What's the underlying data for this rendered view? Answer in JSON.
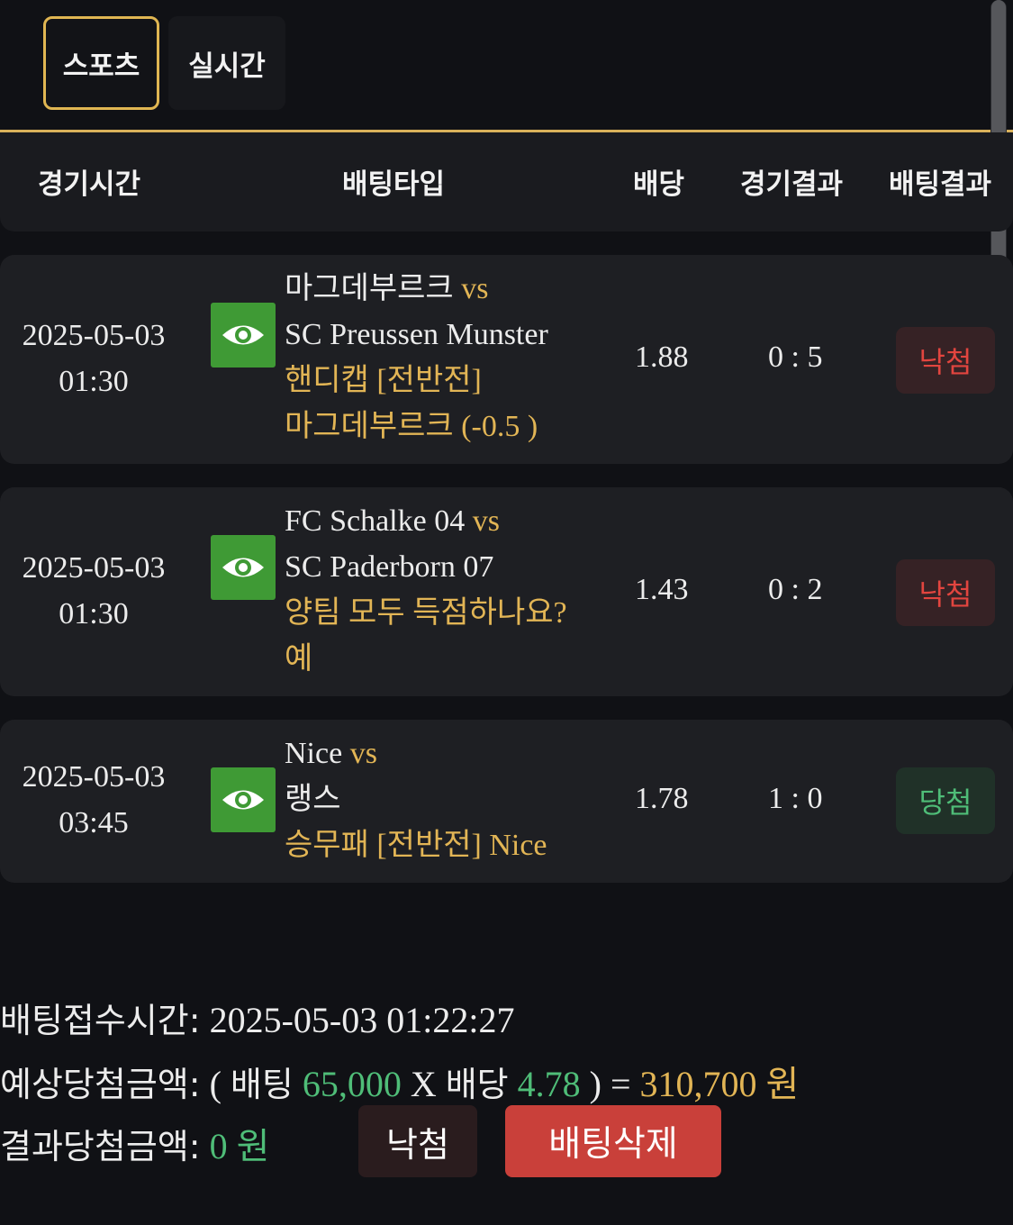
{
  "tabs": [
    {
      "label": "스포츠",
      "active": true
    },
    {
      "label": "실시간",
      "active": false
    }
  ],
  "table_header": {
    "time": "경기시간",
    "type": "배팅타입",
    "odds": "배당",
    "game_result": "경기결과",
    "bet_result": "배팅결과"
  },
  "rows": [
    {
      "date": "2025-05-03",
      "time": "01:30",
      "home": "마그데부르크",
      "vs": "vs",
      "away": "SC Preussen Munster",
      "bet_type": "핸디캡 [전반전]",
      "pick": "마그데부르크 (-0.5 )",
      "odds": "1.88",
      "score": "0 : 5",
      "result": "낙첨"
    },
    {
      "date": "2025-05-03",
      "time": "01:30",
      "home": "FC Schalke 04",
      "vs": "vs",
      "away": "SC Paderborn 07",
      "bet_type": "양팀 모두 득점하나요?",
      "pick": "예",
      "odds": "1.43",
      "score": "0 : 2",
      "result": "낙첨"
    },
    {
      "date": "2025-05-03",
      "time": "03:45",
      "home": "Nice",
      "vs": "vs",
      "away": "랭스",
      "bet_type": "승무패 [전반전] Nice",
      "odds": "1.78",
      "score": "1 : 0",
      "result": "당첨"
    }
  ],
  "summary": {
    "received_label": "배팅접수시간:",
    "received_value": "2025-05-03 01:22:27",
    "expected_label": "예상당첨금액:",
    "open_paren": "(",
    "bet_word": "배팅",
    "stake": "65,000",
    "times": "X",
    "odds_word": "배당",
    "total_odds": "4.78",
    "close_eq": ") =",
    "expected_amount": "310,700 원",
    "result_label": "결과당첨금액:",
    "result_amount": "0 원",
    "status_button": "낙첨",
    "delete_button": "배팅삭제"
  },
  "colors": {
    "accent_gold": "#e2b555",
    "win_green": "#4fbd78",
    "lose_red": "#e2453f",
    "delete_red": "#c9403a",
    "eye_green": "#3f9a35"
  },
  "icons": {
    "detail": "eye-icon"
  }
}
